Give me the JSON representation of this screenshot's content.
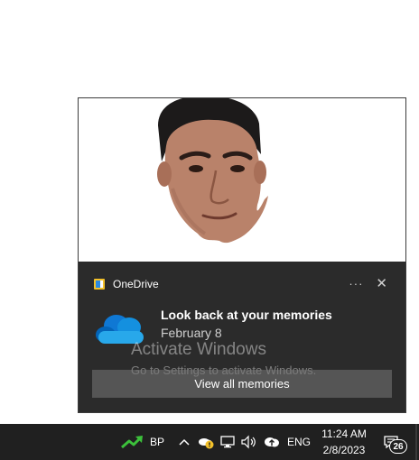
{
  "notification": {
    "app_name": "OneDrive",
    "more_label": "···",
    "close_label": "✕",
    "title": "Look back at your memories",
    "subtitle": "February 8",
    "action_label": "View all memories",
    "app_icon": "onedrive-app-icon",
    "content_icon": "onedrive-cloud-icon",
    "hero_image": "portrait-photo"
  },
  "watermark": {
    "title": "Activate Windows",
    "subtitle": "Go to Settings to activate Windows."
  },
  "taskbar": {
    "stock_label": "BP",
    "language": "ENG",
    "time": "11:24 AM",
    "date": "2/8/2023",
    "notification_count": "26",
    "icons": [
      "stock-trend-icon",
      "chevron-up-icon",
      "onedrive-warning-icon",
      "network-icon",
      "volume-icon",
      "cloud-upload-icon",
      "notification-center-icon"
    ]
  },
  "colors": {
    "toast_bg": "#2b2b2b",
    "taskbar_bg": "#202020",
    "accent_blue": "#0f78d4",
    "stock_green": "#3cc13b"
  }
}
